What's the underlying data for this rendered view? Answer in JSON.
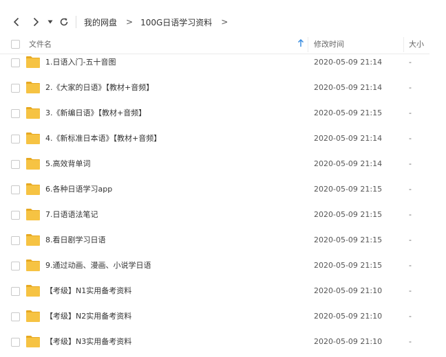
{
  "toolbar": {
    "back_icon": "chevron-left-icon",
    "forward_icon": "chevron-right-icon",
    "history_icon": "caret-down-icon",
    "refresh_icon": "refresh-icon"
  },
  "breadcrumb": {
    "items": [
      "我的网盘",
      "100G日语学习资料"
    ],
    "separator": ">",
    "trailing_separator": ">"
  },
  "header": {
    "name_label": "文件名",
    "time_label": "修改时间",
    "size_label": "大小",
    "sort_icon": "sort-ascending-icon"
  },
  "colors": {
    "folder": "#f6c343",
    "folder_tab": "#e7a922",
    "sort_arrow": "#3b8de0"
  },
  "files": [
    {
      "name": "1.日语入门-五十音图",
      "modified": "2020-05-09 21:14",
      "size": "-"
    },
    {
      "name": "2.《大家的日语》【教材+音频】",
      "modified": "2020-05-09 21:14",
      "size": "-"
    },
    {
      "name": "3.《新编日语》【教材+音频】",
      "modified": "2020-05-09 21:15",
      "size": "-"
    },
    {
      "name": "4.《新标准日本语》【教材+音频】",
      "modified": "2020-05-09 21:14",
      "size": "-"
    },
    {
      "name": "5.高效背单词",
      "modified": "2020-05-09 21:14",
      "size": "-"
    },
    {
      "name": "6.各种日语学习app",
      "modified": "2020-05-09 21:15",
      "size": "-"
    },
    {
      "name": "7.日语语法笔记",
      "modified": "2020-05-09 21:15",
      "size": "-"
    },
    {
      "name": "8.看日剧学习日语",
      "modified": "2020-05-09 21:15",
      "size": "-"
    },
    {
      "name": "9.通过动画、漫画、小说学日语",
      "modified": "2020-05-09 21:15",
      "size": "-"
    },
    {
      "name": "【考级】N1实用备考资料",
      "modified": "2020-05-09 21:10",
      "size": "-"
    },
    {
      "name": "【考级】N2实用备考资料",
      "modified": "2020-05-09 21:10",
      "size": "-"
    },
    {
      "name": "【考级】N3实用备考资料",
      "modified": "2020-05-09 21:10",
      "size": "-"
    }
  ]
}
